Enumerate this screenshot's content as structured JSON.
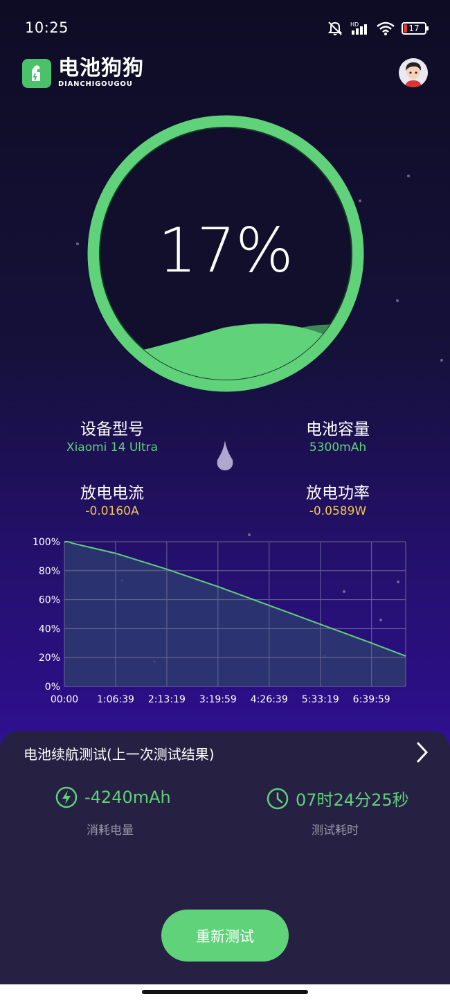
{
  "status_bar": {
    "time": "10:25",
    "battery_level": "17"
  },
  "app": {
    "name": "电池狗狗",
    "name_pinyin": "DIANCHIGOUGOU"
  },
  "gauge": {
    "percent_text": "17%",
    "level": 0.17,
    "color": "#5fd27a"
  },
  "device_info": {
    "model_label": "设备型号",
    "model_value": "Xiaomi 14 Ultra",
    "capacity_label": "电池容量",
    "capacity_value": "5300mAh",
    "current_label": "放电电流",
    "current_value": "-0.0160A",
    "power_label": "放电功率",
    "power_value": "-0.0589W"
  },
  "chart_data": {
    "type": "area",
    "y_ticks": [
      "100%",
      "80%",
      "60%",
      "40%",
      "20%",
      "0%"
    ],
    "x_ticks": [
      "00:00",
      "1:06:39",
      "2:13:19",
      "3:19:59",
      "4:26:39",
      "5:33:19",
      "6:39:59"
    ],
    "ylim": [
      0,
      100
    ],
    "xlim_seconds": [
      0,
      26665
    ],
    "grid": true,
    "series": [
      {
        "x_seconds": [
          0,
          300,
          600,
          3999,
          7999,
          11999,
          15999,
          19999,
          23999,
          26665
        ],
        "values": [
          100,
          100,
          99,
          92,
          81,
          69,
          56,
          43,
          30,
          21
        ]
      }
    ],
    "line_color": "#5fd27a",
    "fill_color": "#2b3a6e"
  },
  "endurance": {
    "title": "电池续航测试(上一次测试结果)",
    "consumed_value": "-4240mAh",
    "consumed_label": "消耗电量",
    "duration_value": "07时24分25秒",
    "duration_label": "测试耗时"
  },
  "actions": {
    "retest_label": "重新测试"
  }
}
